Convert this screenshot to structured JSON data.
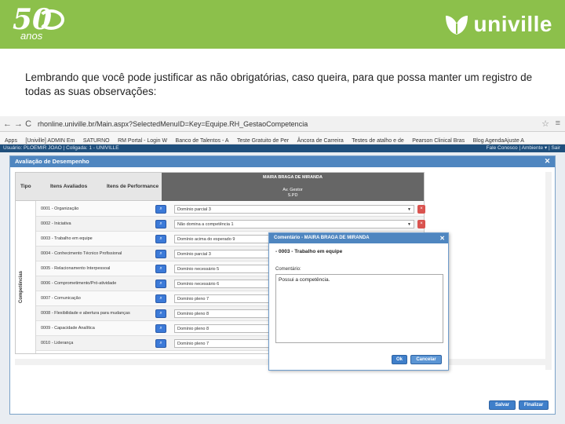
{
  "banner": {
    "logo_number": "50",
    "logo_anos": "anos",
    "brand_name": "univille",
    "color": "#8cc04b"
  },
  "caption": "Lembrando que você pode justificar as não obrigatórias, caso queira, para que possa manter um registro de todas as suas observações:",
  "browser": {
    "nav": "← → C",
    "url": "rhonline.univille.br/Main.aspx?SelectedMenuID=Key=Equipe.RH_GestaoCompetencia",
    "star": "☆",
    "menu": "≡",
    "bookmarks": [
      "Apps",
      "[Univille] ADMIN Em",
      "SATURNO",
      "RM Portal - Login W",
      "Banco de Talentos - A",
      "Teste Gratuito de Per",
      "Âncora de Carreira",
      "Testes de atalho e de",
      "Pearson Clinical Bras",
      "Blog AgendaAjuste A"
    ]
  },
  "appbar": {
    "left": "Usuário: PLOEMIR JOAO | Coligada: 1 - UNIVILLE",
    "right": "Fale Conosco | Ambiente ▾ | Sair"
  },
  "dialog": {
    "title": "Avaliação de Desempenho",
    "close": "✕",
    "headers": {
      "tipo": "Tipo",
      "itens": "Itens Avaliados",
      "itens_perf": "Itens de Performance",
      "person": "MAIRA BRAGA DE MIRANDA",
      "role1": "Av. Gestor",
      "role2": "S.PD"
    },
    "side_label": "Competências",
    "rows": [
      {
        "label": "0001 - Organização",
        "value": "Domínio parcial 3",
        "del": true
      },
      {
        "label": "0002 - Iniciativa",
        "value": "Não domina a competência 1",
        "del": true
      },
      {
        "label": "0003 - Trabalho em equipe",
        "value": "Domínio acima do esperado 9",
        "del": false
      },
      {
        "label": "0004 - Conhecimento Técnico Profissional",
        "value": "Domínio parcial 3",
        "del": false
      },
      {
        "label": "0005 - Relacionamento Interpessoal",
        "value": "Domínio necessário 5",
        "del": false
      },
      {
        "label": "0006 - Comprometimento/Pró-atividade",
        "value": "Domínio necessário 6",
        "del": false
      },
      {
        "label": "0007 - Comunicação",
        "value": "Domínio pleno 7",
        "del": false
      },
      {
        "label": "0008 - Flexibilidade e abertura para mudanças",
        "value": "Domínio pleno 8",
        "del": false
      },
      {
        "label": "0009 - Capacidade Analítica",
        "value": "Domínio pleno 8",
        "del": false
      },
      {
        "label": "0010 - Liderança",
        "value": "Domínio pleno 7",
        "del": false
      }
    ],
    "buttons": {
      "save": "Salvar",
      "finish": "Finalizar"
    }
  },
  "comment": {
    "title": "Comentário - MAIRA BRAGA DE MIRANDA",
    "close": "✕",
    "subtitle": "- 0003 - Trabalho em equipe",
    "label": "Comentário:",
    "text": "Possui a competência.",
    "ok": "Ok",
    "cancel": "Cancelar"
  }
}
